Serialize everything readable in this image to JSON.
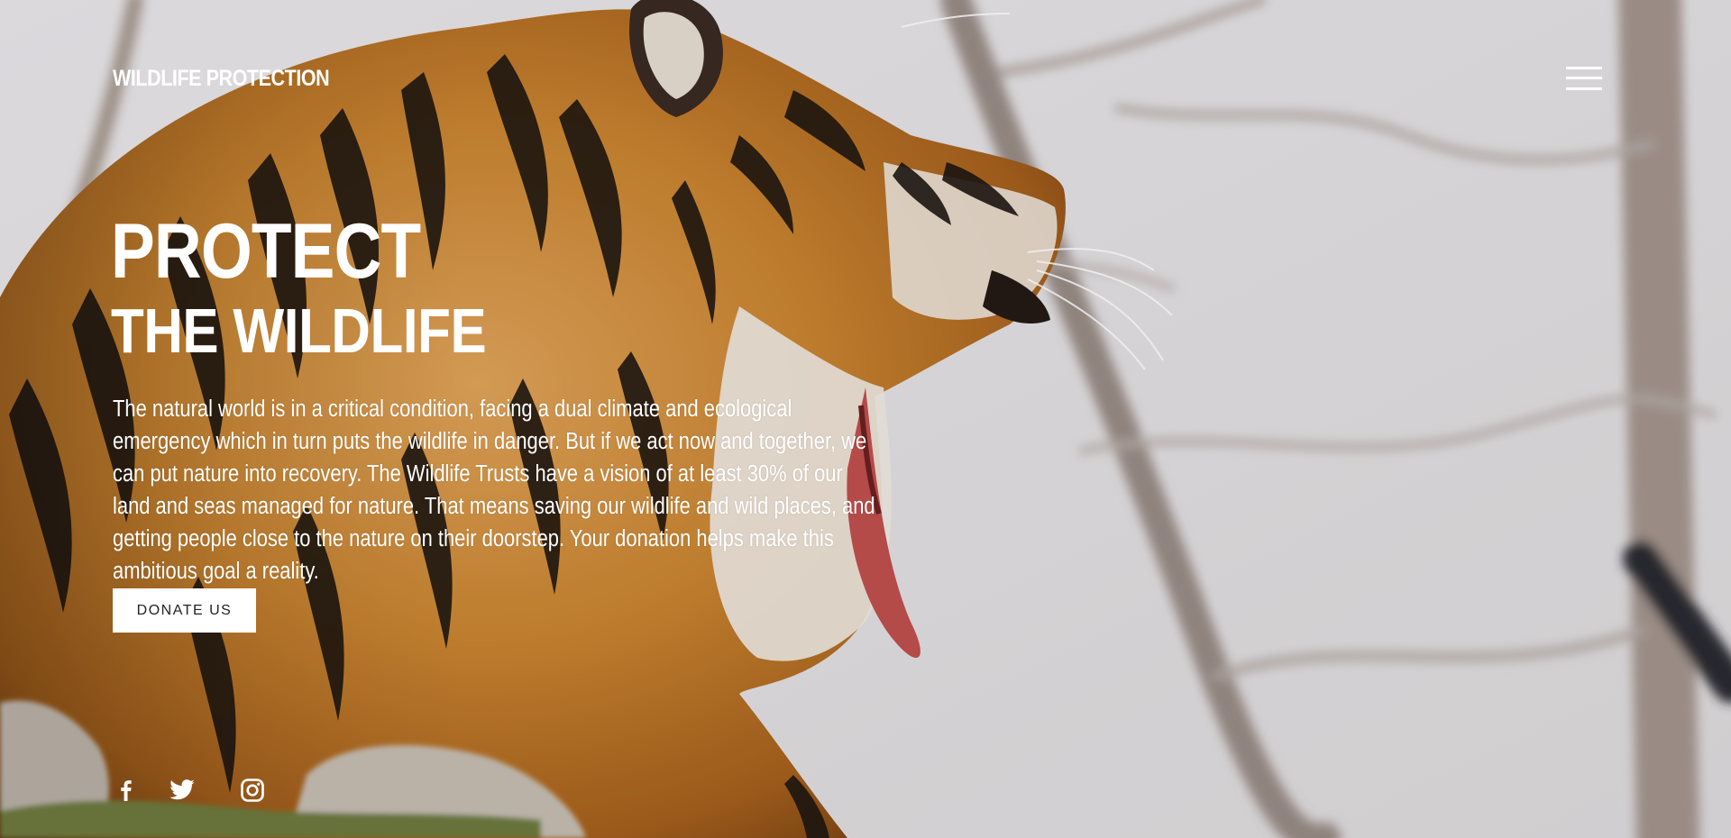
{
  "header": {
    "brand": "WILDLIFE PROTECTION",
    "menu_icon": "hamburger-menu-icon"
  },
  "hero": {
    "headline_line1": "PROTECT",
    "headline_line2": "THE WILDLIFE",
    "body": "The natural world is in a critical condition, facing a dual climate and ecological emergency which in turn puts the wildlife in danger. But if we act now and together, we can put nature into recovery. The Wildlife Trusts have a vision of at least 30% of our land and seas managed for nature. That means saving our wildlife and wild places, and getting people close to the nature on their doorstep. Your donation helps make this ambitious goal a reality.",
    "donate_label": "DONATE US",
    "background_image": "tiger-yawning-photo"
  },
  "social": {
    "icons": [
      "facebook-icon",
      "twitter-icon",
      "instagram-icon"
    ]
  },
  "colors": {
    "text": "#ffffff",
    "button_bg": "#ffffff",
    "button_text": "#222222",
    "tiger_orange": "#c8802f",
    "sky": "#e6e4e6"
  }
}
